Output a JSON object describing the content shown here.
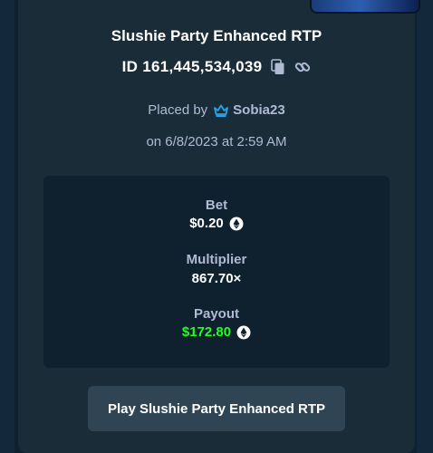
{
  "bet_details": {
    "title": "Slushie Party Enhanced RTP",
    "id_text": "ID 161,445,534,039",
    "placed_by_label": "Placed by",
    "username": "Sobia23",
    "date_text": "on 6/8/2023 at 2:59 AM"
  },
  "stats": {
    "bet_label": "Bet",
    "bet_value": "$0.20",
    "multiplier_label": "Multiplier",
    "multiplier_value": "867.70×",
    "payout_label": "Payout",
    "payout_value": "$172.80"
  },
  "play_button_label": "Play Slushie Party Enhanced RTP",
  "icons": {
    "copy": "copy-icon",
    "link": "link-icon",
    "vip": "crown-icon",
    "currency": "litecoin-icon"
  },
  "colors": {
    "background": "#0f212e",
    "modal": "#1a2c38",
    "muted_text": "#b1bad3",
    "payout_green": "#1fff20",
    "button": "#2f4553"
  }
}
